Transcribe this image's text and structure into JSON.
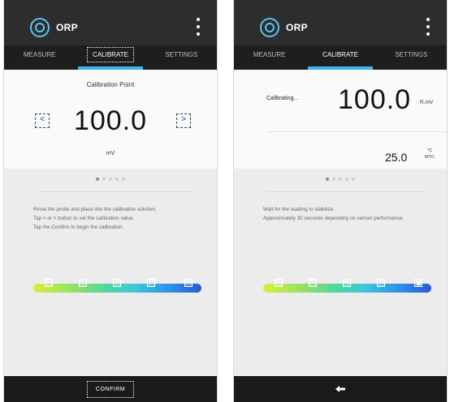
{
  "left_screen": {
    "app_title": "ORP",
    "tabs": [
      "MEASURE",
      "CALIBRATE",
      "SETTINGS"
    ],
    "active_tab": "CALIBRATE",
    "calibration_point_label": "Calibration Point",
    "decrement_label": "<",
    "increment_label": ">",
    "value": "100.0",
    "unit": "mV",
    "instructions": [
      "Rinse the probe and place into the calibration solution.",
      "Tap < or > button to set the calibration value.",
      "Tap the Confirm to begin the calibration."
    ],
    "confirm_label": "CONFIRM"
  },
  "right_screen": {
    "app_title": "ORP",
    "tabs": [
      "MEASURE",
      "CALIBRATE",
      "SETTINGS"
    ],
    "active_tab": "CALIBRATE",
    "calibrating_label": "Calibrating...",
    "value": "100.0",
    "unit": "R.mV",
    "temperature": "25.0",
    "temp_unit": "°C",
    "temp_mode": "MTC",
    "instructions": [
      "Wait for the reading to stabilize.",
      "Approximately 30 seconds depending on sensor performance."
    ]
  },
  "colors": {
    "accent": "#3fb2e8",
    "titlebar": "#2d2d2d",
    "bottombar": "#1a1a1a"
  },
  "icons": {
    "logo": "gear-ring-icon",
    "menu": "more-vertical-icon",
    "back": "back-arrow-icon"
  },
  "pager": {
    "pages": 5,
    "current": 1
  }
}
